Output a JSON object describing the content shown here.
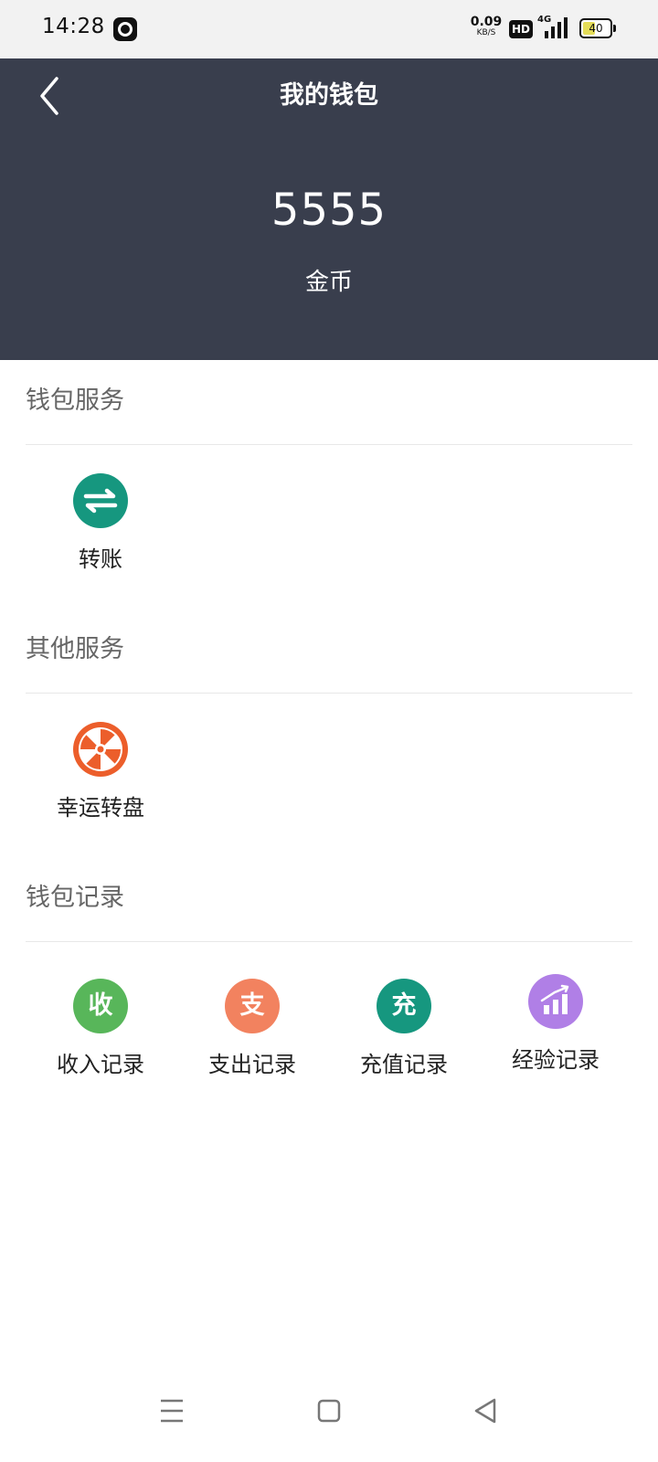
{
  "status_bar": {
    "time": "14:28",
    "speed_value": "0.09",
    "speed_unit": "KB/S",
    "hd_label": "HD",
    "network": "4G",
    "battery_level": "40"
  },
  "header": {
    "title": "我的钱包",
    "balance": "5555",
    "balance_unit": "金币",
    "background": "#393e4d"
  },
  "sections": [
    {
      "title": "钱包服务",
      "items": [
        {
          "label": "转账",
          "icon": "transfer-icon",
          "color": "#16977f"
        }
      ]
    },
    {
      "title": "其他服务",
      "items": [
        {
          "label": "幸运转盘",
          "icon": "lucky-wheel-icon",
          "color": "#ec5e2b"
        }
      ]
    },
    {
      "title": "钱包记录",
      "items": [
        {
          "label": "收入记录",
          "icon": "income-icon",
          "glyph": "收",
          "color": "#58b65a"
        },
        {
          "label": "支出记录",
          "icon": "expense-icon",
          "glyph": "支",
          "color": "#f2825f"
        },
        {
          "label": "充值记录",
          "icon": "recharge-icon",
          "glyph": "充",
          "color": "#16977f"
        },
        {
          "label": "经验记录",
          "icon": "experience-chart-icon",
          "color": "#b07fe6"
        }
      ]
    }
  ]
}
